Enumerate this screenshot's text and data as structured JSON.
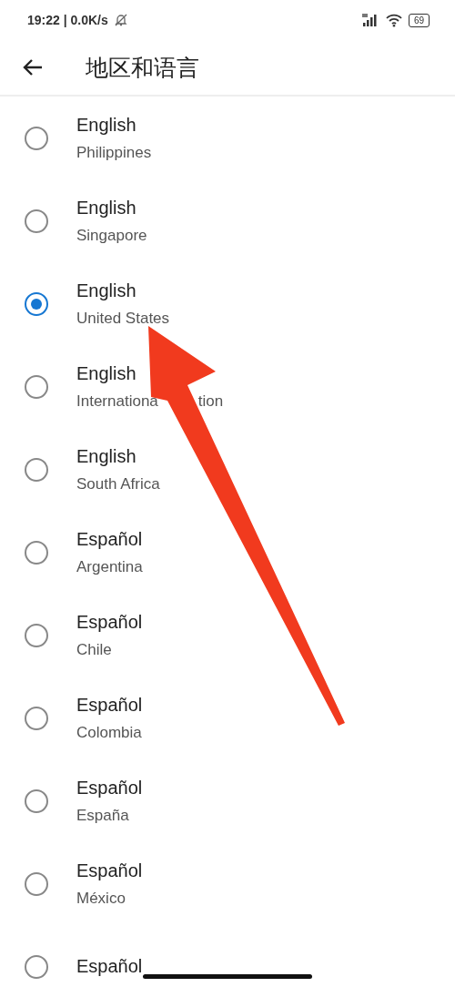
{
  "status_bar": {
    "time": "19:22 | 0.0K/s",
    "battery": "69"
  },
  "header": {
    "title": "地区和语言"
  },
  "locales": [
    {
      "language": "English",
      "region": [
        "Philippines"
      ],
      "selected": false
    },
    {
      "language": "English",
      "region": [
        "Singapore"
      ],
      "selected": false
    },
    {
      "language": "English",
      "region": [
        "United States"
      ],
      "selected": true
    },
    {
      "language": "English",
      "region": [
        "Internationa",
        "tion"
      ],
      "selected": false
    },
    {
      "language": "English",
      "region": [
        "South Africa"
      ],
      "selected": false
    },
    {
      "language": "Español",
      "region": [
        "Argentina"
      ],
      "selected": false
    },
    {
      "language": "Español",
      "region": [
        "Chile"
      ],
      "selected": false
    },
    {
      "language": "Español",
      "region": [
        "Colombia"
      ],
      "selected": false
    },
    {
      "language": "Español",
      "region": [
        "España"
      ],
      "selected": false
    },
    {
      "language": "Español",
      "region": [
        "México"
      ],
      "selected": false
    },
    {
      "language": "Español",
      "selected": false
    }
  ]
}
